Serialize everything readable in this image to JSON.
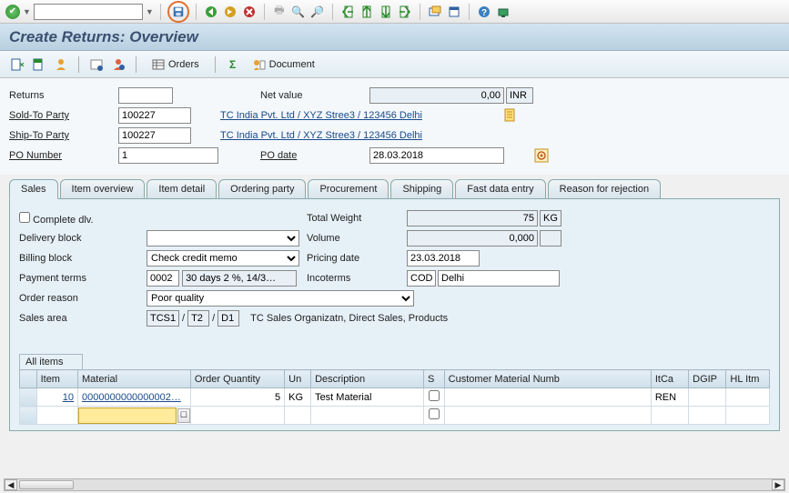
{
  "title": "Create Returns: Overview",
  "sub_toolbar": {
    "orders_label": "Orders",
    "document_label": "Document"
  },
  "header": {
    "returns_label": "Returns",
    "returns_value": "",
    "netvalue_label": "Net value",
    "netvalue_value": "0,00",
    "netvalue_curr": "INR",
    "soldto_label": "Sold-To Party",
    "soldto_value": "100227",
    "soldto_link": "TC India Pvt. Ltd / XYZ Stree3 / 123456 Delhi",
    "shipto_label": "Ship-To Party",
    "shipto_value": "100227",
    "shipto_link": "TC India Pvt. Ltd / XYZ Stree3 / 123456 Delhi",
    "ponum_label": "PO Number",
    "ponum_value": "1",
    "podate_label": "PO date",
    "podate_value": "28.03.2018"
  },
  "tabs": [
    "Sales",
    "Item overview",
    "Item detail",
    "Ordering party",
    "Procurement",
    "Shipping",
    "Fast data entry",
    "Reason for rejection"
  ],
  "sales": {
    "complete_dlv_label": "Complete dlv.",
    "total_weight_label": "Total Weight",
    "total_weight_value": "75",
    "total_weight_unit": "KG",
    "delivery_block_label": "Delivery block",
    "delivery_block_value": "",
    "volume_label": "Volume",
    "volume_value": "0,000",
    "volume_unit": "",
    "billing_block_label": "Billing block",
    "billing_block_value": "Check credit memo",
    "pricing_date_label": "Pricing date",
    "pricing_date_value": "23.03.2018",
    "payment_terms_label": "Payment terms",
    "payment_terms_code": "0002",
    "payment_terms_text": "30 days 2 %, 14/3…",
    "incoterms_label": "Incoterms",
    "incoterms_code": "COD",
    "incoterms_text": "Delhi",
    "order_reason_label": "Order reason",
    "order_reason_value": "Poor quality",
    "sales_area_label": "Sales area",
    "sales_area_code1": "TCS1",
    "sales_area_code2": "T2",
    "sales_area_code3": "D1",
    "sales_area_text": "TC Sales Organizatn, Direct Sales, Products"
  },
  "table": {
    "title": "All items",
    "cols": {
      "item": "Item",
      "material": "Material",
      "qty": "Order Quantity",
      "un": "Un",
      "desc": "Description",
      "s": "S",
      "cust": "Customer Material Numb",
      "itca": "ItCa",
      "dgip": "DGIP",
      "hl": "HL Itm"
    },
    "rows": [
      {
        "item": "10",
        "material": "0000000000000002…",
        "qty": "5",
        "un": "KG",
        "desc": "Test Material",
        "s": false,
        "cust": "",
        "itca": "REN",
        "dgip": "",
        "hl": ""
      },
      {
        "item": "",
        "material": "",
        "qty": "",
        "un": "",
        "desc": "",
        "s": false,
        "cust": "",
        "itca": "",
        "dgip": "",
        "hl": ""
      }
    ]
  }
}
